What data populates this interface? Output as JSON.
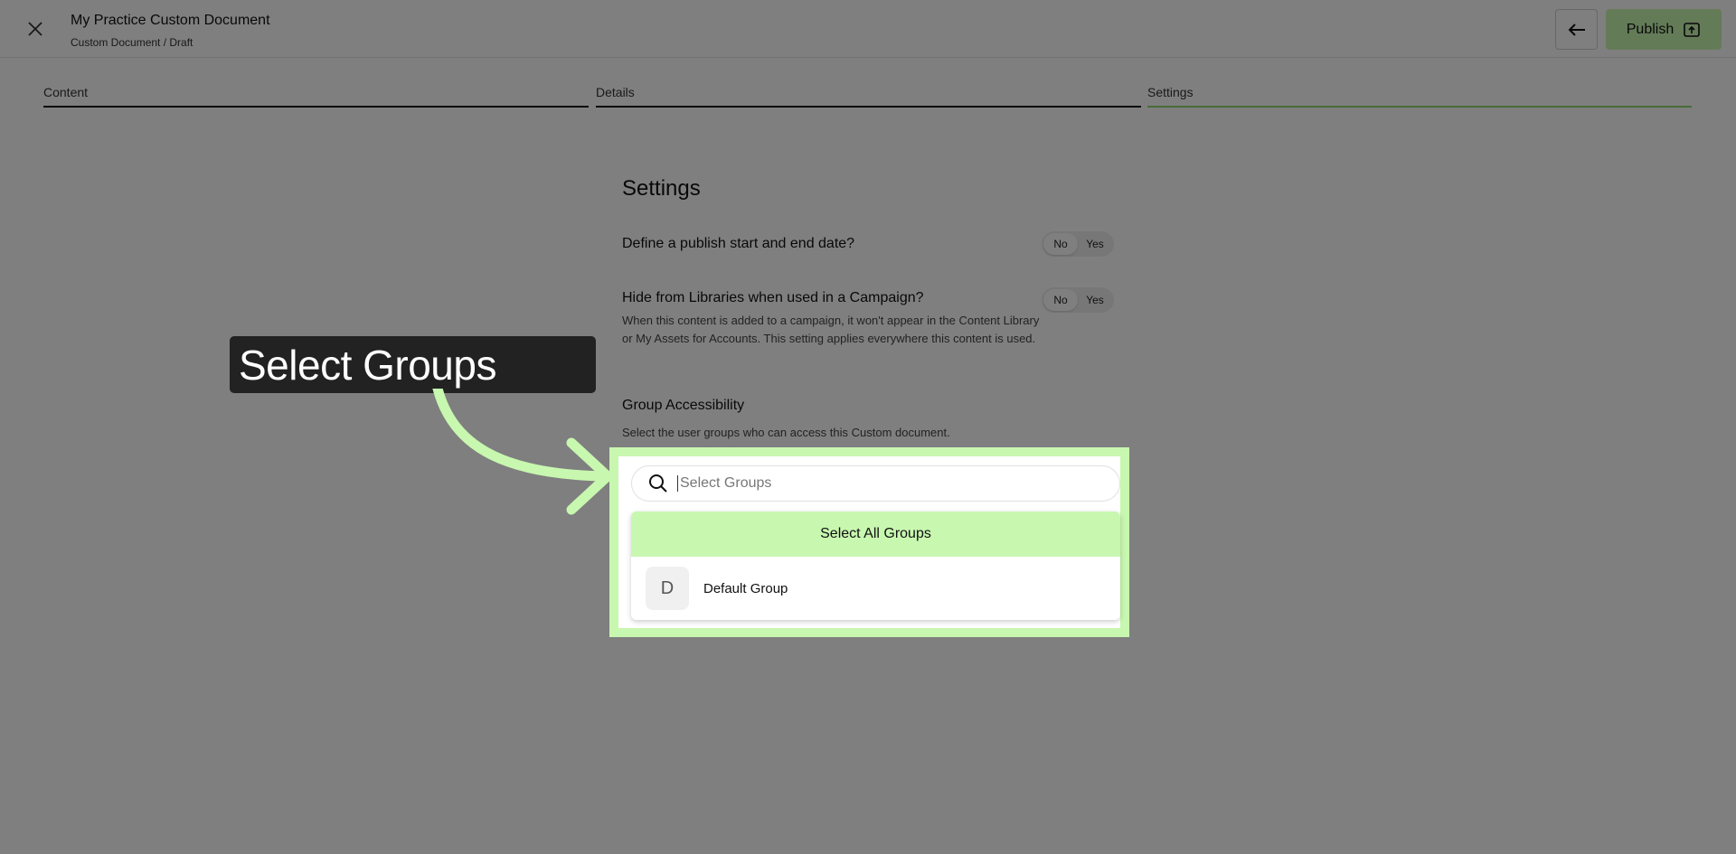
{
  "header": {
    "title": "My Practice Custom Document",
    "breadcrumb": "Custom Document / Draft",
    "publish_label": "Publish"
  },
  "steps": [
    {
      "label": "Content"
    },
    {
      "label": "Details"
    },
    {
      "label": "Settings",
      "active": true
    }
  ],
  "settings": {
    "title": "Settings",
    "publish_dates": {
      "question": "Define a publish start and end date?",
      "no": "No",
      "yes": "Yes",
      "selected": "No"
    },
    "hide_libraries": {
      "question": "Hide from Libraries when used in a Campaign?",
      "description": "When this content is added to a campaign, it won't appear in the Content Library or My Assets for Accounts. This setting applies everywhere this content is used.",
      "no": "No",
      "yes": "Yes",
      "selected": "No"
    },
    "group_access": {
      "title": "Group Accessibility",
      "description": "Select the user groups who can access this Custom document.",
      "search_placeholder": "Select Groups",
      "select_all_label": "Select All Groups",
      "groups": [
        {
          "initial": "D",
          "name": "Default Group"
        }
      ]
    }
  },
  "callout": {
    "text": "Select Groups"
  },
  "colors": {
    "accent": "#c8f7b0",
    "callout_bg": "#222222",
    "step_active": "#8fd86e"
  }
}
